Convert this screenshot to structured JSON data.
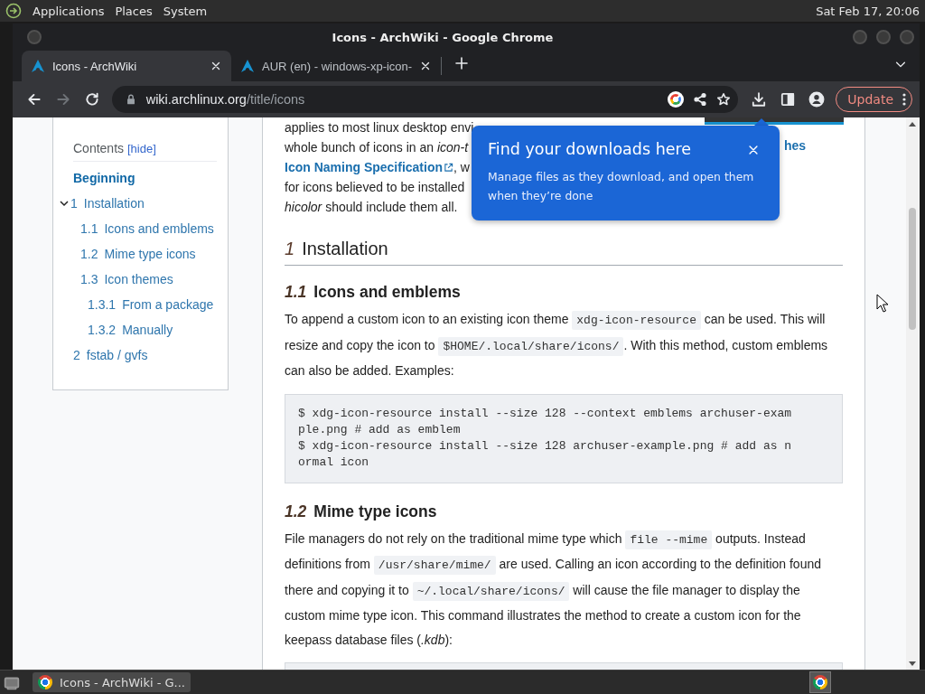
{
  "top_panel": {
    "menus": [
      "Applications",
      "Places",
      "System"
    ],
    "clock": "Sat Feb 17, 20:06"
  },
  "window": {
    "title": "Icons - ArchWiki - Google Chrome"
  },
  "tabs": [
    {
      "title": "Icons - ArchWiki",
      "selected": true
    },
    {
      "title": "AUR (en) - windows-xp-icon-",
      "selected": false
    }
  ],
  "nav": [
    {
      "kind": "back",
      "disabled": false
    },
    {
      "kind": "forward",
      "disabled": true
    },
    {
      "kind": "reload",
      "disabled": false
    }
  ],
  "address": {
    "host": "wiki.archlinux.org",
    "path": "/title/icons"
  },
  "update_button": "Update",
  "toc": {
    "title": "Contents",
    "toggle": "[hide]",
    "items": [
      {
        "label": "Beginning",
        "selected": true
      },
      {
        "number": "1",
        "label": "Installation",
        "selected": false,
        "expanded": true,
        "children": [
          {
            "number": "1.1",
            "label": "Icons and emblems",
            "selected": false
          },
          {
            "number": "1.2",
            "label": "Mime type icons",
            "selected": false
          },
          {
            "number": "1.3",
            "label": "Icon themes",
            "selected": false,
            "children": [
              {
                "number": "1.3.1",
                "label": "From a package",
                "selected": false
              },
              {
                "number": "1.3.2",
                "label": "Manually",
                "selected": false
              }
            ]
          }
        ]
      },
      {
        "number": "2",
        "label": "fstab / gvfs",
        "selected": false
      }
    ]
  },
  "article": {
    "intro_lines": [
      [
        {
          "kind": "text",
          "text": "applies to most linux desktop envi"
        }
      ],
      [
        {
          "kind": "text",
          "text": "whole bunch of icons in an *icon-t*"
        }
      ],
      [
        {
          "kind": "link",
          "text": "Icon Naming Specification",
          "external": true
        },
        {
          "kind": "text",
          "text": ", w"
        }
      ],
      [
        {
          "kind": "text",
          "text": "for icons believed to be installed"
        }
      ],
      [
        {
          "kind": "text",
          "text": "*hicolor* should include them all."
        }
      ]
    ],
    "side_box": {
      "link": "hes"
    },
    "sections": [
      {
        "kind": "h2",
        "number": "1",
        "title": "Installation"
      },
      {
        "kind": "h3",
        "number": "1.1",
        "title": "Icons and emblems"
      },
      {
        "kind": "paragraph",
        "segments": [
          {
            "kind": "text",
            "text": "To append a custom icon to an existing icon theme "
          },
          {
            "kind": "code",
            "text": "xdg-icon-resource"
          },
          {
            "kind": "text",
            "text": " can be used. This will resize and copy the icon to "
          },
          {
            "kind": "code",
            "text": "$HOME/.local/share/icons/"
          },
          {
            "kind": "text",
            "text": ". With this method, custom emblems can also be added. Examples:"
          }
        ]
      },
      {
        "kind": "code",
        "lines": [
          "$ xdg-icon-resource install --size 128 --context emblems archuser-exam",
          "ple.png # add as emblem",
          "$ xdg-icon-resource install --size 128 archuser-example.png # add as n",
          "ormal icon"
        ]
      },
      {
        "kind": "h3",
        "number": "1.2",
        "title": "Mime type icons"
      },
      {
        "kind": "paragraph",
        "segments": [
          {
            "kind": "text",
            "text": "File managers do not rely on the traditional mime type which "
          },
          {
            "kind": "code",
            "text": "file --mime"
          },
          {
            "kind": "text",
            "text": " outputs. Instead definitions from "
          },
          {
            "kind": "code",
            "text": "/usr/share/mime/"
          },
          {
            "kind": "text",
            "text": " are used. Calling an icon according to the definition found there and copying it to "
          },
          {
            "kind": "code",
            "text": "~/.local/share/icons/"
          },
          {
            "kind": "text",
            "text": " will cause the file manager to display the custom mime type icon. This command illustrates the method to create a custom icon for the keepass database files (*.kdb*):"
          }
        ]
      },
      {
        "kind": "code"
      }
    ]
  },
  "popup": {
    "title": "Find your downloads here",
    "message": "Manage files as they download, and open them when they’re done"
  },
  "taskbar": {
    "tasks": [
      {
        "title": "Icons - ArchWiki - G...",
        "selected": true
      }
    ]
  }
}
